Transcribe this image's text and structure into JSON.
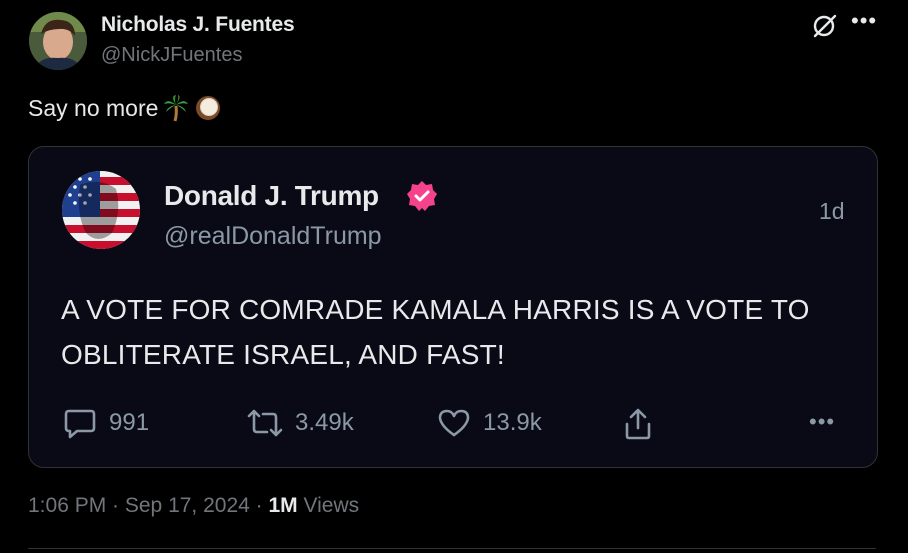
{
  "post": {
    "author_name": "Nicholas J. Fuentes",
    "author_handle": "@NickJFuentes",
    "text": "Say no more",
    "emojis": [
      "palm-tree-icon",
      "coconut-icon"
    ],
    "timestamp": "1:06 PM · Sep 17, 2024 · ",
    "views_count": "1M",
    "views_label": " Views"
  },
  "quoted": {
    "author_name": "Donald J. Trump",
    "author_handle": "@realDonaldTrump",
    "age": "1d",
    "text": "A VOTE FOR COMRADE KAMALA HARRIS IS A VOTE TO OBLITERATE ISRAEL, AND FAST!",
    "replies": "991",
    "reposts": "3.49k",
    "likes": "13.9k"
  },
  "colors": {
    "background": "#000000",
    "card": "#0a0a16",
    "muted": "#71767b",
    "badge": "#f4428c"
  }
}
